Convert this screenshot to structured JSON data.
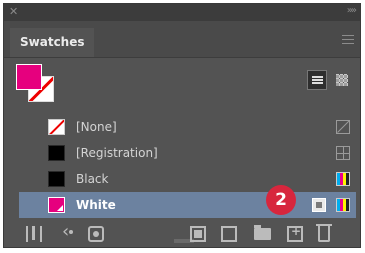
{
  "panel": {
    "tab_label": "Swatches"
  },
  "fill_stroke": {
    "fill_color": "#e6007e"
  },
  "view_buttons": [
    {
      "name": "list-view",
      "active": true
    },
    {
      "name": "thumbnail-view",
      "active": false
    }
  ],
  "swatches": [
    {
      "label": "[None]",
      "chip": "none",
      "right_icon": "non-printing-icon"
    },
    {
      "label": "[Registration]",
      "chip": "registration",
      "right_icon": "registration-icon"
    },
    {
      "label": "Black",
      "chip": "black",
      "right_icon": "cmyk-icon"
    },
    {
      "label": "White",
      "chip": "magenta",
      "right_icon": "cmyk-icon",
      "selected": true
    }
  ],
  "callout": {
    "number": "2",
    "color": "#d7263d"
  },
  "colors": {
    "panel_bg": "#535353",
    "selection": "#6c82a0",
    "magenta": "#e6007e"
  }
}
